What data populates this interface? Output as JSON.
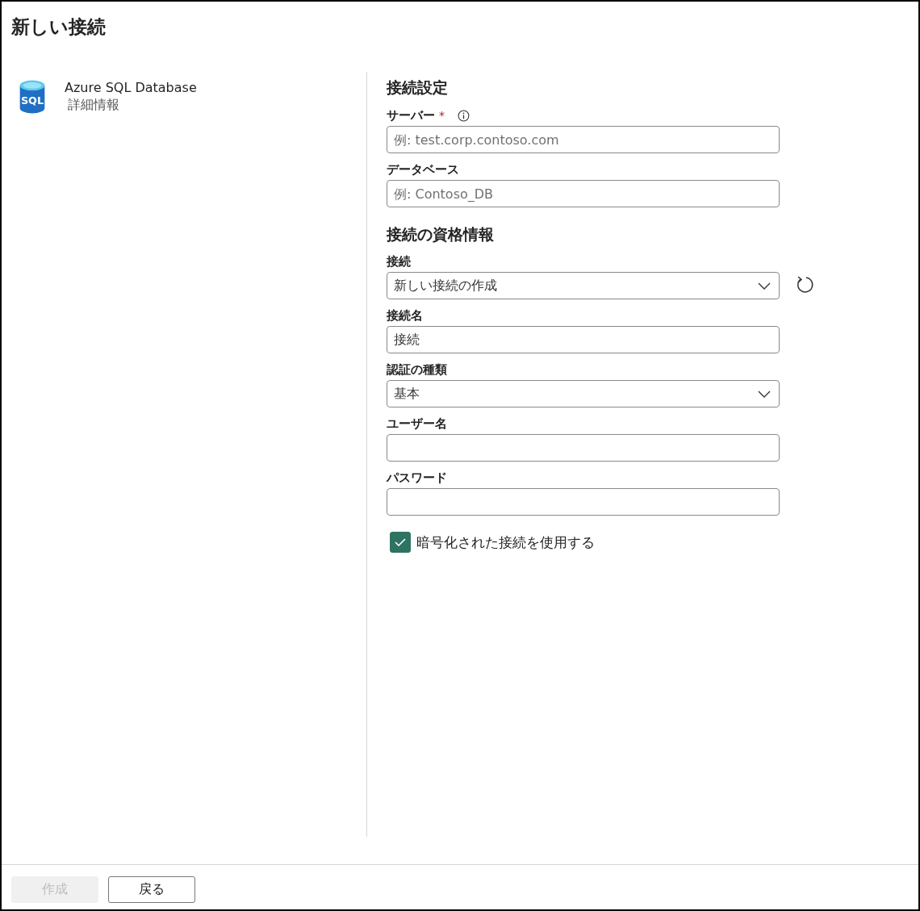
{
  "window": {
    "title": "新しい接続"
  },
  "source": {
    "icon_text": "SQL",
    "name": "Azure SQL Database",
    "details_link": "詳細情報"
  },
  "sections": [
    {
      "heading": "接続設定",
      "fields": [
        {
          "kind": "text",
          "label": "サーバー",
          "required_mark": "*",
          "info": true,
          "placeholder": "例: test.corp.contoso.com"
        },
        {
          "kind": "text",
          "label": "データベース",
          "info": false,
          "placeholder": "例: Contoso_DB"
        }
      ]
    },
    {
      "heading": "接続の資格情報",
      "fields": [
        {
          "kind": "dropdown",
          "label": "接続",
          "info": false,
          "value": "新しい接続の作成",
          "refresh": true
        },
        {
          "kind": "text",
          "label": "接続名",
          "info": false,
          "value": "接続"
        },
        {
          "kind": "dropdown",
          "label": "認証の種類",
          "info": false,
          "value": "基本",
          "refresh": false
        },
        {
          "kind": "text",
          "label": "ユーザー名",
          "info": false
        },
        {
          "kind": "password",
          "label": "パスワード",
          "info": false
        }
      ]
    }
  ],
  "encrypted": {
    "label": "暗号化された接続を使用する",
    "checked": true
  },
  "buttons": [
    {
      "label": "作成",
      "disabled": true
    },
    {
      "label": "戻る",
      "disabled": false
    }
  ]
}
